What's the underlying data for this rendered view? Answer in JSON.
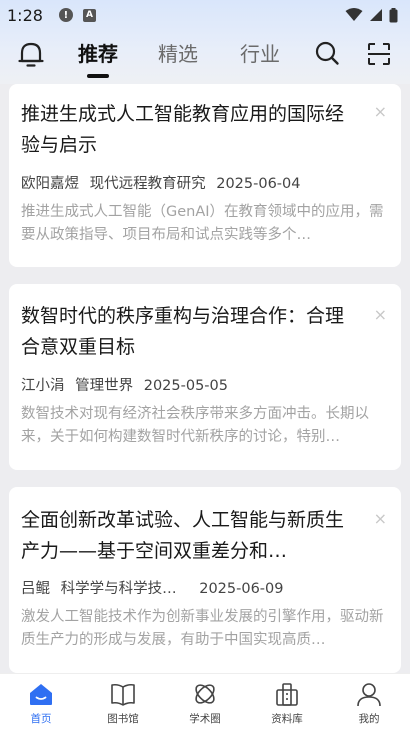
{
  "status_bar": {
    "time": "1:28",
    "notif_a": "!",
    "notif_b": "A"
  },
  "nav": {
    "tabs": [
      {
        "label": "推荐",
        "active": true
      },
      {
        "label": "精选",
        "active": false
      },
      {
        "label": "行业",
        "active": false
      }
    ]
  },
  "feed": {
    "close_glyph": "×",
    "cards": [
      {
        "title": "推进生成式人工智能教育应用的国际经验与启示",
        "author": "欧阳嘉煜",
        "source": "现代远程教育研究",
        "date": "2025-06-04",
        "summary": "推进生成式人工智能（GenAI）在教育领域中的应用，需要从政策指导、项目布局和试点实践等多个…"
      },
      {
        "title": "数智时代的秩序重构与治理合作：合理合意双重目标",
        "author": "江小涓",
        "source": "管理世界",
        "date": "2025-05-05",
        "summary": "数智技术对现有经济社会秩序带来多方面冲击。长期以来，关于如何构建数智时代新秩序的讨论，特别…"
      },
      {
        "title": "全面创新改革试验、人工智能与新质生产力——基于空间双重差分和…",
        "author": "吕鲲",
        "source": "科学学与科学技…",
        "date": "2025-06-09",
        "summary": "激发人工智能技术作为创新事业发展的引擎作用，驱动新质生产力的形成与发展，有助于中国实现高质…"
      }
    ]
  },
  "bottom_nav": {
    "items": [
      {
        "label": "首页",
        "icon": "home-icon",
        "active": true
      },
      {
        "label": "图书馆",
        "icon": "book-icon",
        "active": false
      },
      {
        "label": "学术圈",
        "icon": "academic-circle-icon",
        "active": false
      },
      {
        "label": "资料库",
        "icon": "database-icon",
        "active": false
      },
      {
        "label": "我的",
        "icon": "profile-icon",
        "active": false
      }
    ]
  },
  "colors": {
    "accent": "#2f6ff2",
    "text": "#1a1a1a",
    "muted": "#a3a3a3"
  }
}
